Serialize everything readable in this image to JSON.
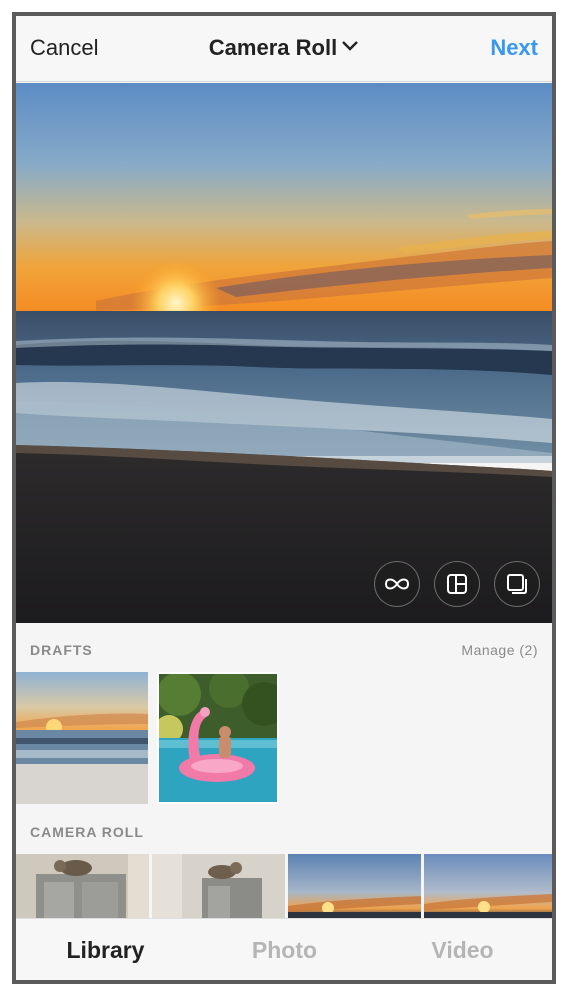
{
  "header": {
    "cancel_label": "Cancel",
    "title": "Camera Roll",
    "next_label": "Next"
  },
  "preview": {
    "tools": [
      "boomerang-icon",
      "layout-icon",
      "multi-select-icon"
    ]
  },
  "drafts": {
    "label": "DRAFTS",
    "manage_label": "Manage (2)",
    "items": [
      "beach sunset draft",
      "pink flamingo float draft"
    ]
  },
  "camera_roll": {
    "label": "CAMERA ROLL"
  },
  "tabs": [
    {
      "label": "Library",
      "active": true
    },
    {
      "label": "Photo",
      "active": false
    },
    {
      "label": "Video",
      "active": false
    }
  ],
  "colors": {
    "accent": "#3897f0",
    "text": "#222222",
    "muted": "#8a8a8a",
    "inactive_tab": "#b5b5b5"
  }
}
